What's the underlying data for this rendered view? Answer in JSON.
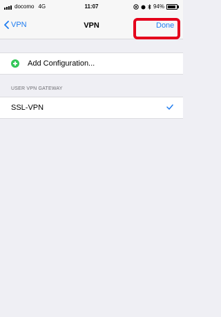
{
  "status_bar": {
    "carrier": "docomo",
    "network": "4G",
    "time": "11:07",
    "battery": "94%",
    "battery_level": 0.94
  },
  "nav": {
    "back_label": "VPN",
    "title": "VPN",
    "done_label": "Done",
    "highlight_color": "#e4001b"
  },
  "add_configuration": {
    "label": "Add Configuration..."
  },
  "section": {
    "header": "USER VPN GATEWAY"
  },
  "vpn_list": [
    {
      "name": "SSL-VPN",
      "selected": true
    }
  ],
  "colors": {
    "accent": "#1e7cf0",
    "add_icon": "#34c759",
    "background": "#efeff4"
  }
}
